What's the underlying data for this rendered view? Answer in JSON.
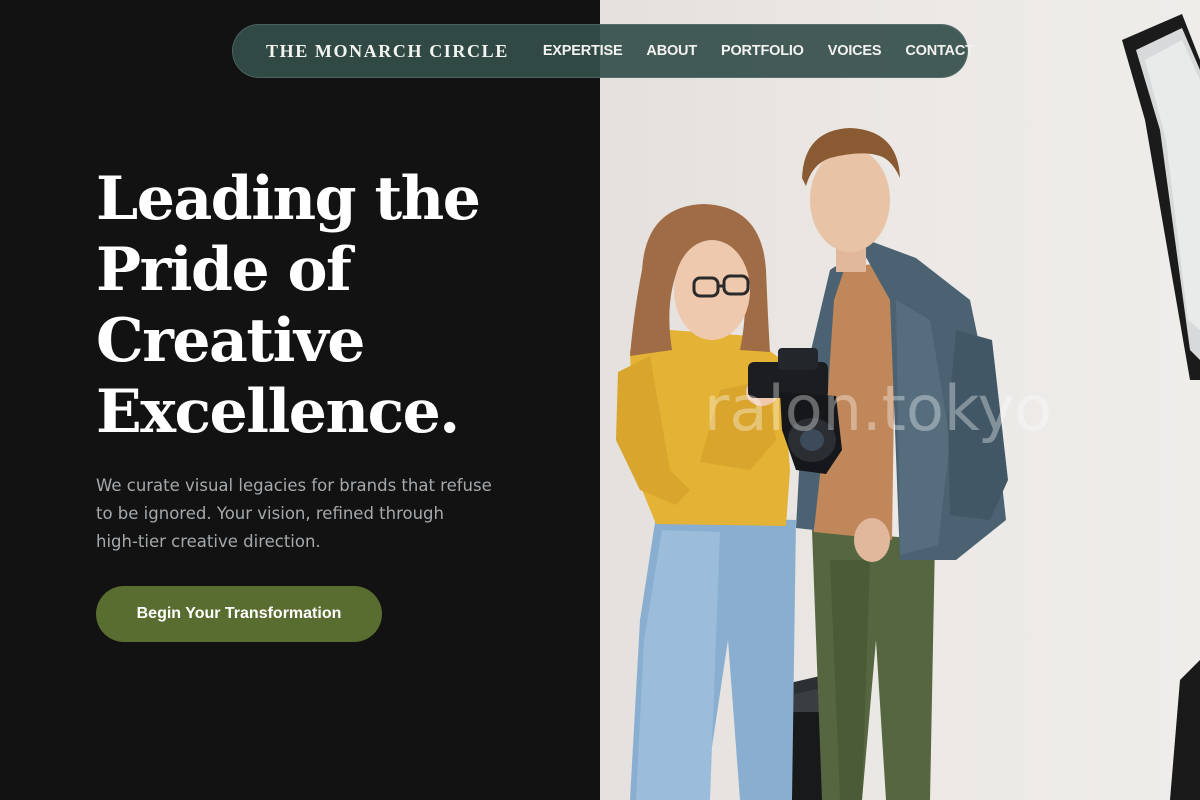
{
  "brand": {
    "name": "THE MONARCH CIRCLE"
  },
  "nav": {
    "links": [
      {
        "label": "EXPERTISE"
      },
      {
        "label": "ABOUT"
      },
      {
        "label": "PORTFOLIO"
      },
      {
        "label": "VOICES"
      },
      {
        "label": "CONTACT"
      }
    ]
  },
  "hero": {
    "title_lines": [
      "Leading the",
      "Pride of",
      "Creative",
      "Excellence."
    ],
    "description_lines": [
      "We curate visual legacies for brands that refuse",
      "to be ignored. Your vision, refined through",
      "high-tier creative direction."
    ],
    "cta_label": "Begin Your Transformation"
  },
  "photo": {
    "watermark": "ralon.tokyo",
    "subject": "two people looking at a camera in a photo studio"
  },
  "colors": {
    "background": "#121212",
    "nav_background": "#344e4a",
    "cta_background": "#5a6d31",
    "text_primary": "#ffffff",
    "text_muted": "#a5a9ac"
  }
}
